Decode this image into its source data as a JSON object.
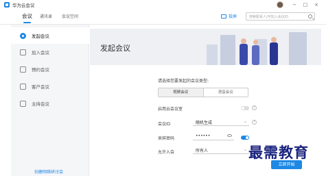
{
  "app": {
    "title": "华为云会议"
  },
  "window": {
    "minimize": "−",
    "maximize": "□",
    "close": "×"
  },
  "nav": {
    "tabs": [
      {
        "label": "会议",
        "active": true
      },
      {
        "label": "通讯录",
        "active": false
      },
      {
        "label": "会议空间",
        "active": false
      }
    ],
    "share_label": "投屏",
    "search_placeholder": "搜索联系人/可加入会议ID"
  },
  "sidebar": {
    "items": [
      {
        "label": "发起会议",
        "active": true
      },
      {
        "label": "加入会议",
        "active": false
      },
      {
        "label": "预约会议",
        "active": false
      },
      {
        "label": "客户会议",
        "active": false
      },
      {
        "label": "主持会议",
        "active": false
      }
    ],
    "bottom_link": "创建网络研讨会"
  },
  "main": {
    "banner_title": "发起会议",
    "prompt": "请选择您要发起的会议类型:",
    "meeting_types": [
      {
        "label": "视频会议",
        "active": true
      },
      {
        "label": "语音会议",
        "active": false
      }
    ],
    "cloud_meeting_room": {
      "label": "启用云会议室",
      "enabled": false
    },
    "meeting_id": {
      "label": "会议ID",
      "value": "随机生成"
    },
    "guest_password": {
      "label": "来宾密码",
      "value": "••••••",
      "enabled": true
    },
    "allow_join": {
      "label": "允许入会",
      "value": "所有人"
    },
    "start_button": "立即开始"
  },
  "watermark": "最需教育",
  "colors": {
    "accent": "#1e88e5",
    "sidebar_bg": "#f5f6f8",
    "banner_bg": "#eef0f4"
  }
}
